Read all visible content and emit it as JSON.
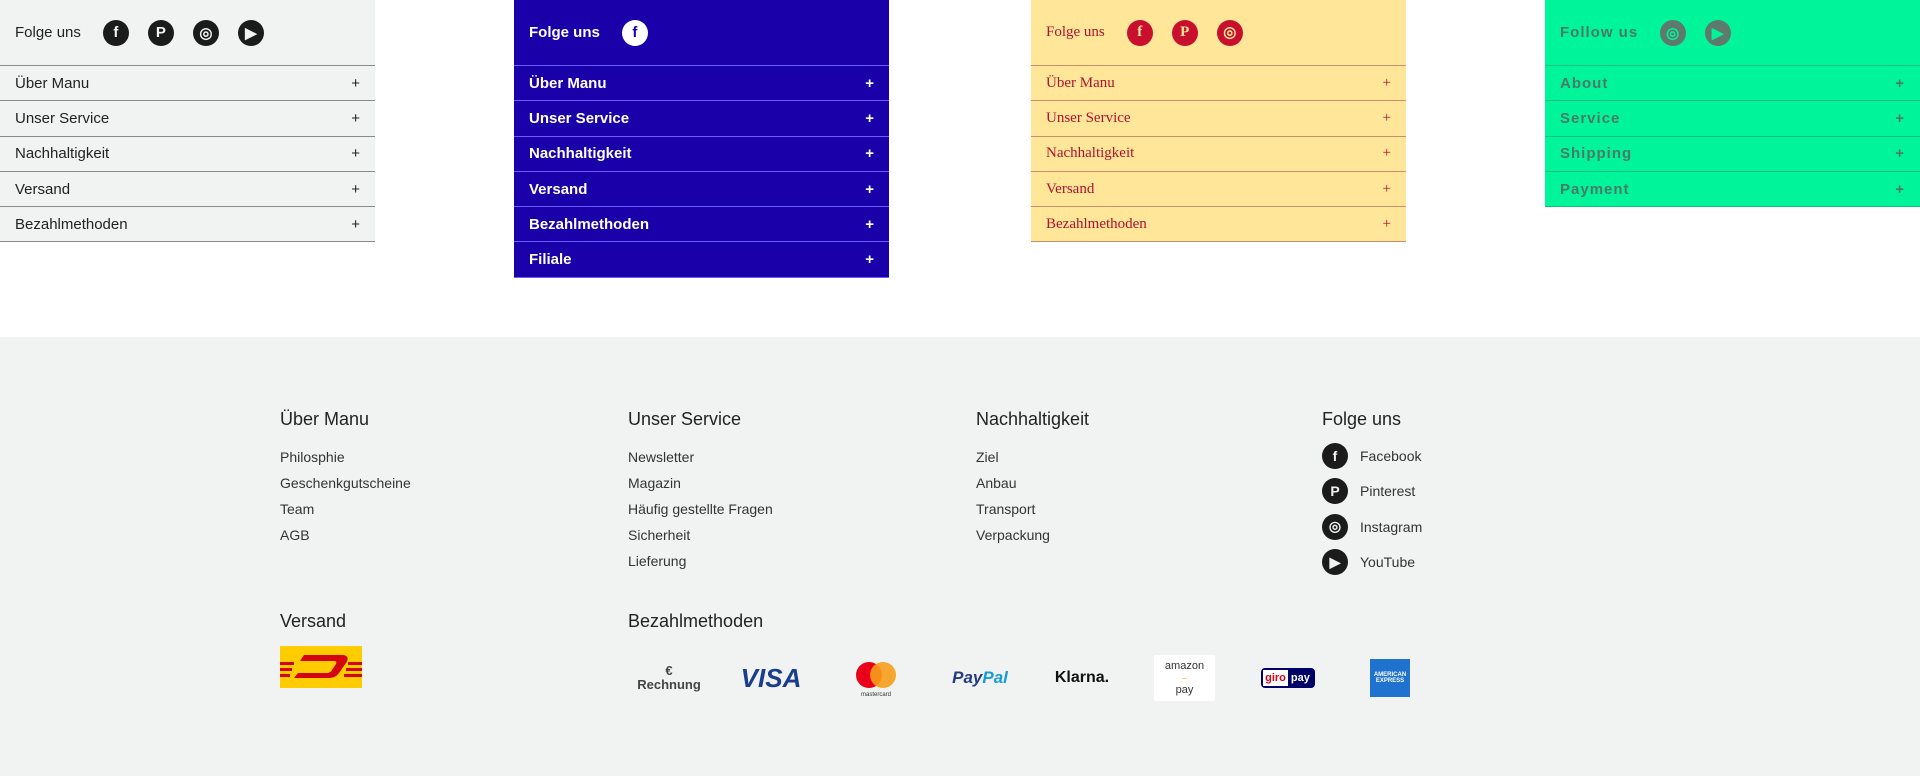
{
  "panels": [
    {
      "cls": "p1",
      "title": "Folge uns",
      "icons": [
        "facebook-icon",
        "pinterest-icon",
        "instagram-icon",
        "youtube-icon"
      ],
      "items": [
        "Über Manu",
        "Unser Service",
        "Nachhaltigkeit",
        "Versand",
        "Bezahlmethoden"
      ]
    },
    {
      "cls": "p2",
      "title": "Folge uns",
      "icons": [
        "facebook-icon"
      ],
      "items": [
        "Über Manu",
        "Unser Service",
        "Nachhaltigkeit",
        "Versand",
        "Bezahlmethoden",
        "Filiale"
      ]
    },
    {
      "cls": "p3",
      "title": "Folge uns",
      "icons": [
        "facebook-icon",
        "pinterest-icon",
        "instagram-icon"
      ],
      "items": [
        "Über Manu",
        "Unser Service",
        "Nachhaltigkeit",
        "Versand",
        "Bezahlmethoden"
      ]
    },
    {
      "cls": "p4",
      "title": "Follow us",
      "icons": [
        "instagram-icon",
        "youtube-icon"
      ],
      "items": [
        "About",
        "Service",
        "Shipping",
        "Payment"
      ]
    }
  ],
  "expand_symbol": "+",
  "footer": {
    "columns": [
      {
        "title": "Über Manu",
        "links": [
          "Philosphie",
          "Geschenkgutscheine",
          "Team",
          "AGB"
        ]
      },
      {
        "title": "Unser Service",
        "links": [
          "Newsletter",
          "Magazin",
          "Häufig gestellte Fragen",
          "Sicherheit",
          "Lieferung"
        ]
      },
      {
        "title": "Nachhaltigkeit",
        "links": [
          "Ziel",
          "Anbau",
          "Transport",
          "Verpackung"
        ]
      }
    ],
    "social": {
      "title": "Folge uns",
      "items": [
        {
          "label": "Facebook",
          "icon": "facebook-icon"
        },
        {
          "label": "Pinterest",
          "icon": "pinterest-icon"
        },
        {
          "label": "Instagram",
          "icon": "instagram-icon"
        },
        {
          "label": "YouTube",
          "icon": "youtube-icon"
        }
      ]
    },
    "shipping": {
      "title": "Versand",
      "logo": "DHL"
    },
    "payment": {
      "title": "Bezahlmethoden",
      "methods": [
        "€ Rechnung",
        "VISA",
        "mastercard",
        "PayPal",
        "Klarna.",
        "amazon pay",
        "giropay",
        "AMERICAN EXPRESS"
      ]
    }
  },
  "colors": {
    "blue": "#1a00a8",
    "yellow": "#ffe699",
    "red": "#c8102e",
    "green": "#00f59b",
    "footer_bg": "#f0f3f2"
  }
}
